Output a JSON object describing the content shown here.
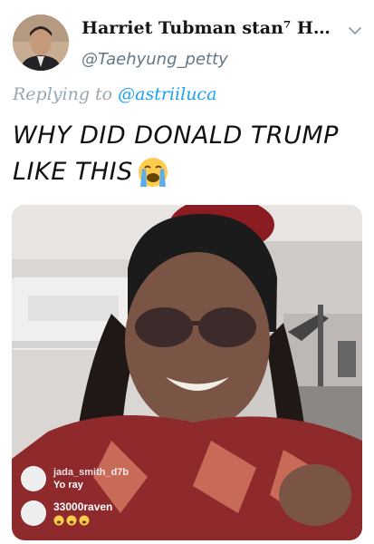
{
  "author": {
    "name": "Harriet Tubman stan⁷ Hwa...",
    "handle": "@Taehyung_petty"
  },
  "reply": {
    "prefix": "Replying to",
    "handle": "@astriiluca"
  },
  "tweet": {
    "text_line1": "WHY DID DONALD TRUMP",
    "text_line2": "LIKE THIS",
    "emoji": "loudly-crying-face-icon"
  },
  "media": {
    "comments": [
      {
        "user": "jada_smith_d7b",
        "text": "Yo ray"
      },
      {
        "user": "33000raven",
        "text": ""
      }
    ]
  },
  "colors": {
    "link": "#1da1f2",
    "secondary_text": "#657786"
  }
}
